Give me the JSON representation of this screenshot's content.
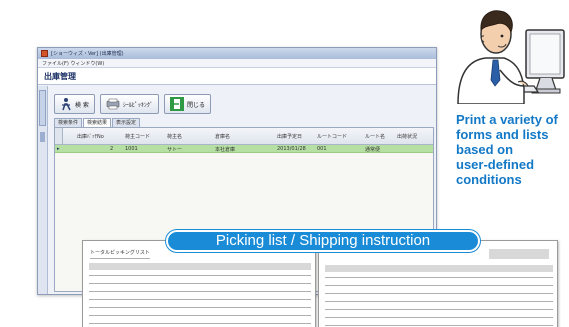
{
  "window": {
    "titlebar_text": "[ショーウィズ・Ver] (出庫管理)",
    "menu_text": "ファイル(F)  ウィンドウ(W)",
    "app_title": "出庫管理"
  },
  "toolbar": {
    "search_label": "検 索",
    "picking_label": "ｼｰﾙﾋﾟｯｷﾝｸﾞ",
    "close_label": "閉じる"
  },
  "tabs": [
    "検索条件",
    "検索結果",
    "表示設定"
  ],
  "grid": {
    "headers": [
      "出庫ﾊﾞｯﾁNo",
      "荷主コード",
      "荷主名",
      "倉庫名",
      "出庫予定日",
      "ルートコード",
      "ルート名",
      "出荷状況"
    ],
    "rows": [
      {
        "marker": "▸",
        "cells": [
          "2",
          "1001",
          "サトー",
          "本社倉庫",
          "2013/01/28",
          "001",
          "通常便",
          ""
        ]
      }
    ]
  },
  "caption": "Print a variety of\nforms and lists\nbased on\nuser-defined\nconditions",
  "banner": "Picking list / Shipping instruction",
  "documents": [
    {
      "title": "トータルピッキングリスト"
    },
    {
      "title": ""
    }
  ],
  "colors": {
    "accent": "#1a8bd6",
    "caption": "#1379c7",
    "selected_row": "#b6e0a3"
  },
  "icons": [
    "app-icon",
    "search-icon",
    "picking-icon",
    "close-icon",
    "person-at-computer-illustration"
  ]
}
